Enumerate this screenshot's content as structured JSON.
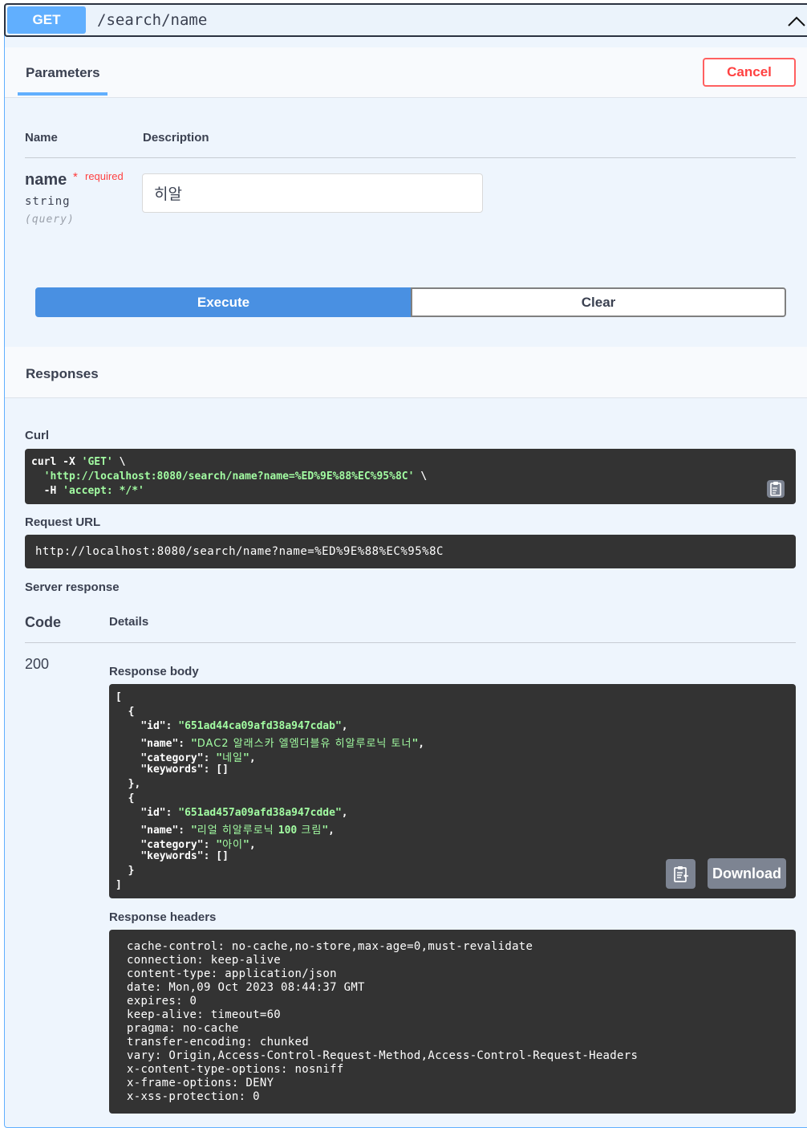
{
  "endpoint": {
    "method": "GET",
    "path": "/search/name"
  },
  "parameters_section": {
    "tab_label": "Parameters",
    "cancel_label": "Cancel"
  },
  "param_table": {
    "col_name": "Name",
    "col_description": "Description",
    "param": {
      "name": "name",
      "required_marker": "*",
      "required_label": "required",
      "type": "string",
      "location": "(query)",
      "value": "히알"
    }
  },
  "actions": {
    "execute_label": "Execute",
    "clear_label": "Clear"
  },
  "responses": {
    "title": "Responses",
    "curl_label": "Curl",
    "curl_lines": [
      {
        "plain": "curl -X ",
        "str": "'GET'",
        "tail": " \\"
      },
      {
        "plain": "  ",
        "str": "'http://localhost:8080/search/name?name=%ED%9E%88%EC%95%8C'",
        "tail": " \\"
      },
      {
        "plain": "  -H ",
        "str": "'accept: */*'",
        "tail": ""
      }
    ],
    "request_url_label": "Request URL",
    "request_url": "http://localhost:8080/search/name?name=%ED%9E%88%EC%95%8C",
    "server_response_label": "Server response",
    "code_header": "Code",
    "details_header": "Details",
    "status_code": "200",
    "body_label": "Response body",
    "items": [
      {
        "id": "651ad44ca09afd38a947cdab",
        "name": "DAC2 알래스카 엘엠더블유 히알루로닉 토너",
        "category": "네일",
        "keywords": "[]"
      },
      {
        "id": "651ad457a09afd38a947cdde",
        "name_pre": "리얼 히알루로닉 ",
        "name_num": "100",
        "name_post": " 크림",
        "category": "아이",
        "keywords": "[]"
      }
    ],
    "download_label": "Download",
    "headers_label": "Response headers",
    "headers": [
      "cache-control: no-cache,no-store,max-age=0,must-revalidate",
      "connection: keep-alive",
      "content-type: application/json",
      "date: Mon,09 Oct 2023 08:44:37 GMT",
      "expires: 0",
      "keep-alive: timeout=60",
      "pragma: no-cache",
      "transfer-encoding: chunked",
      "vary: Origin,Access-Control-Request-Method,Access-Control-Request-Headers",
      "x-content-type-options: nosniff",
      "x-frame-options: DENY",
      "x-xss-protection: 0"
    ]
  },
  "colors": {
    "accent": "#61affe",
    "execute": "#4990e2",
    "cancel": "#ff4141",
    "code_bg": "#333333",
    "string_green": "#a2fca2"
  }
}
